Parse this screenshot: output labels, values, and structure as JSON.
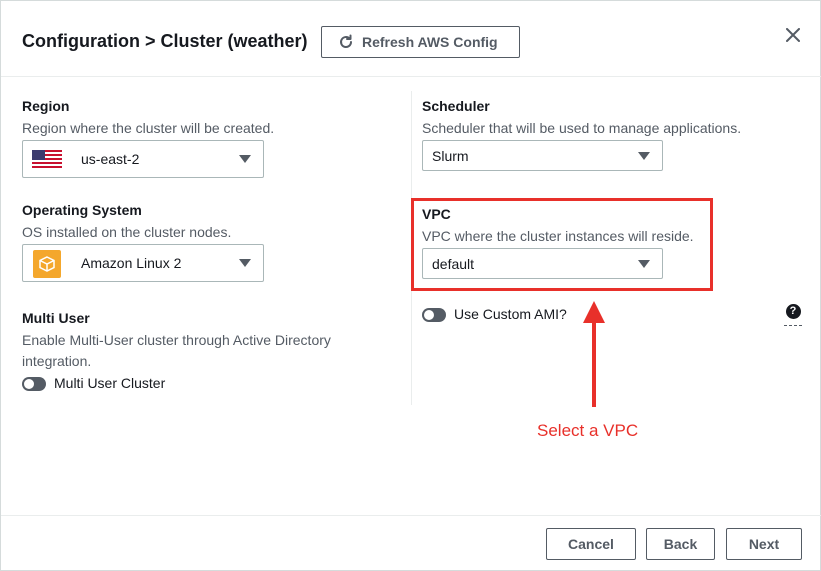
{
  "header": {
    "title": "Configuration > Cluster (weather)",
    "refresh_label": "Refresh AWS Config",
    "close_icon": "close-icon"
  },
  "left": {
    "region": {
      "label": "Region",
      "description": "Region where the cluster will be created.",
      "value": "us-east-2",
      "icon": "us-flag-icon"
    },
    "os": {
      "label": "Operating System",
      "description": "OS installed on the cluster nodes.",
      "value": "Amazon Linux 2",
      "icon": "aws-box-icon"
    },
    "multi_user": {
      "label": "Multi User",
      "description": "Enable Multi-User cluster through Active Directory integration.",
      "toggle_label": "Multi User Cluster",
      "toggle_on": false
    }
  },
  "right": {
    "scheduler": {
      "label": "Scheduler",
      "description": "Scheduler that will be used to manage applications.",
      "value": "Slurm"
    },
    "vpc": {
      "label": "VPC",
      "description": "VPC where the cluster instances will reside.",
      "value": "default"
    },
    "custom_ami": {
      "toggle_label": "Use Custom AMI?",
      "toggle_on": false,
      "help_icon": "question-icon"
    }
  },
  "annotation": {
    "text": "Select a VPC",
    "color": "#e8302a"
  },
  "footer": {
    "cancel_label": "Cancel",
    "back_label": "Back",
    "next_label": "Next"
  }
}
